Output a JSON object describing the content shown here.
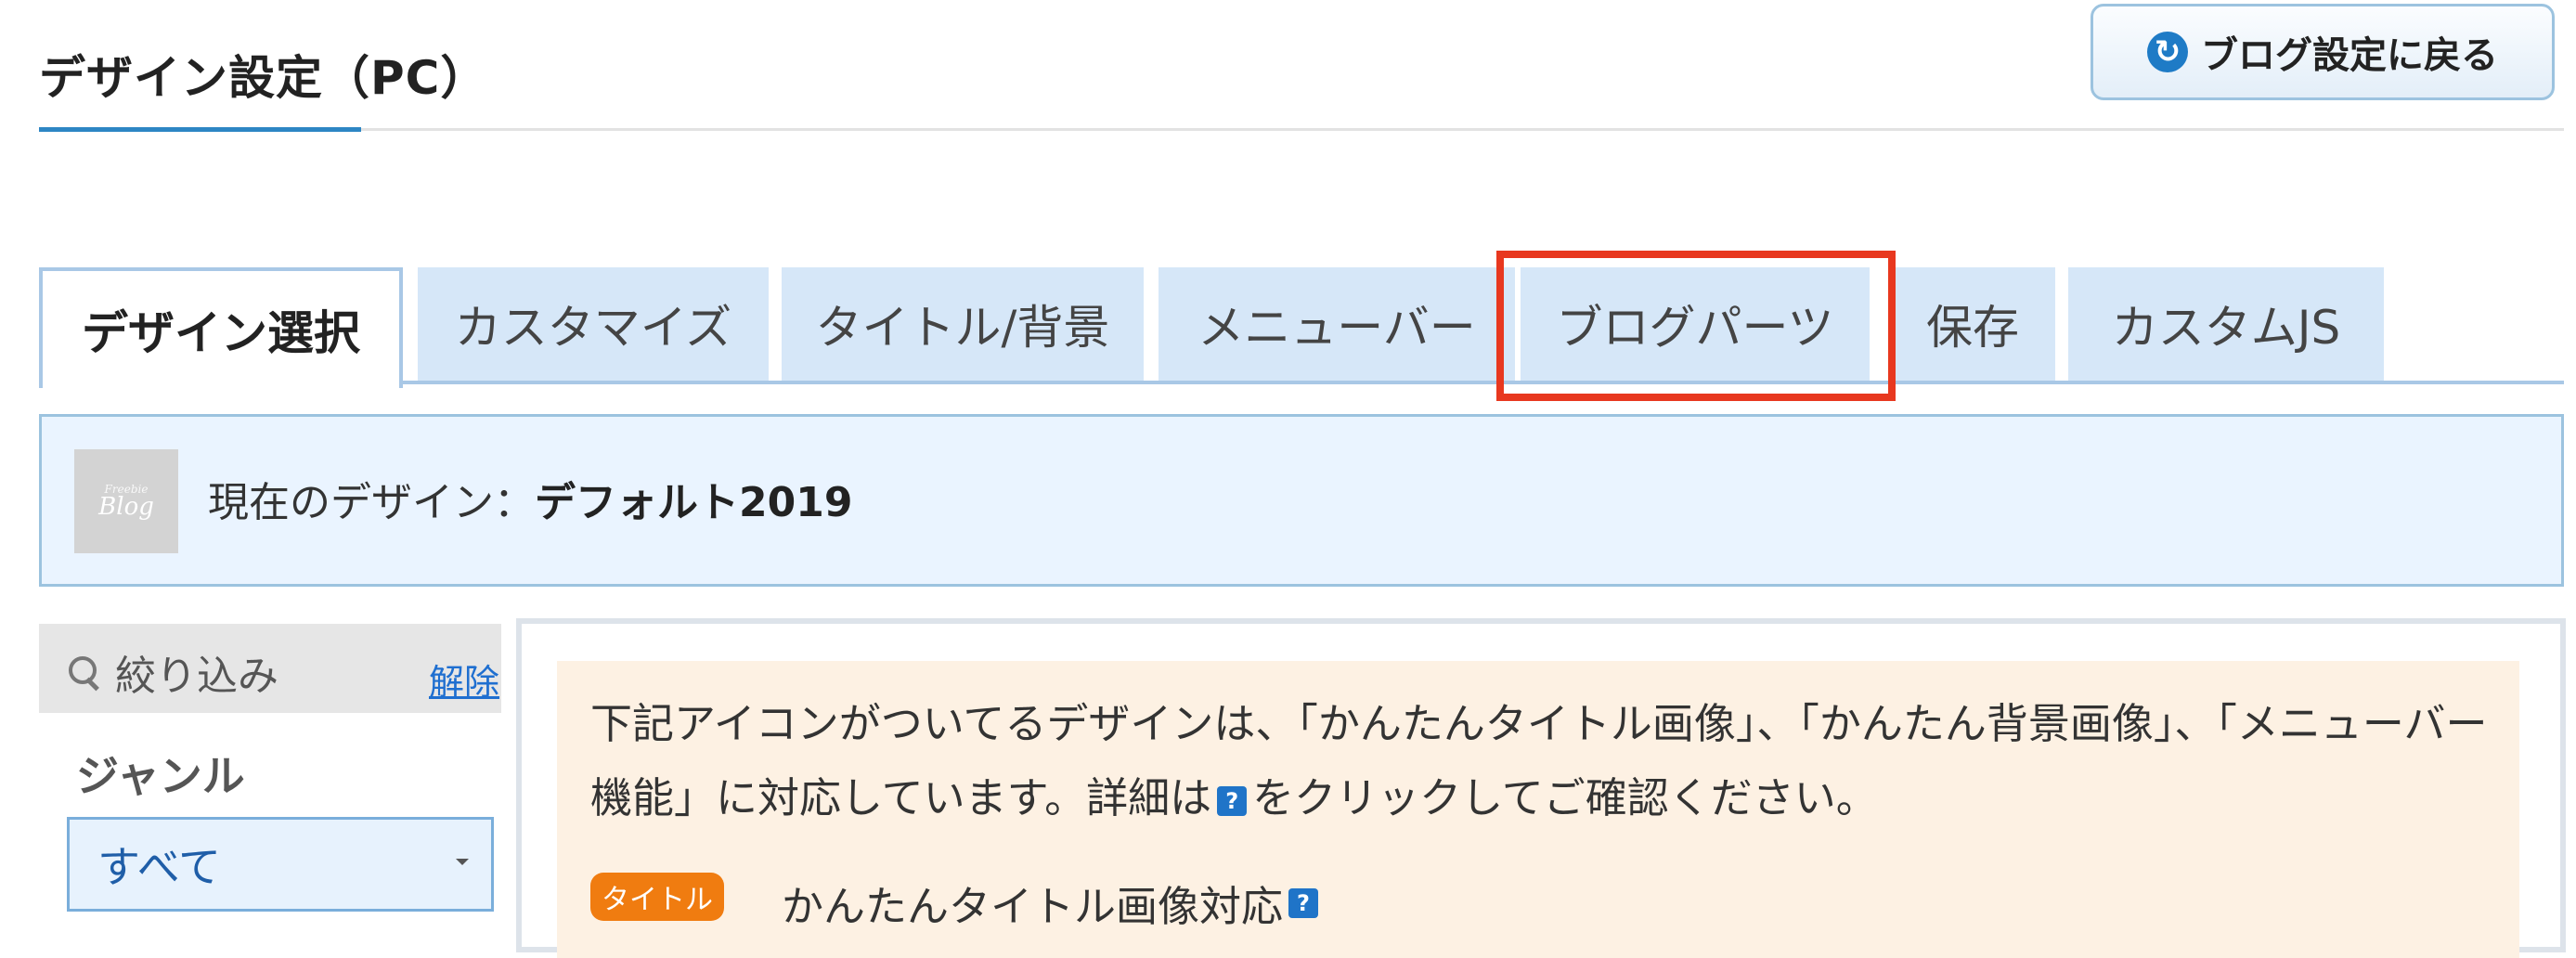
{
  "header": {
    "title": "デザイン設定（PC）",
    "back_button_label": "ブログ設定に戻る"
  },
  "tabs": [
    {
      "label": "デザイン選択",
      "active": true
    },
    {
      "label": "カスタマイズ"
    },
    {
      "label": "タイトル/背景"
    },
    {
      "label": "メニューバー"
    },
    {
      "label": "ブログパーツ",
      "highlighted": true
    },
    {
      "label": "保存"
    },
    {
      "label": "カスタムJS"
    }
  ],
  "current_design": {
    "thumbnail_small": "Freebie",
    "thumbnail_big": "Blog",
    "label": "現在のデザイン：",
    "name": "デフォルト2019"
  },
  "filter": {
    "label": "絞り込み",
    "clear": "解除",
    "genre_label": "ジャンル",
    "genre_value": "すべて"
  },
  "notice": {
    "line_before_icon": "下記アイコンがついてるデザインは、「かんたんタイトル画像」、「かんたん背景画像」、「メニューバー機能」に対応しています。詳細は",
    "line_after_icon": "をクリックしてご確認ください。",
    "help_glyph": "?",
    "badge_label": "タイトル",
    "badge_description": "かんたんタイトル画像対応"
  },
  "colors": {
    "highlight": "#e8381f",
    "tab_bg": "#d6e7f8",
    "link": "#1f6fd0",
    "badge": "#f07c10"
  }
}
